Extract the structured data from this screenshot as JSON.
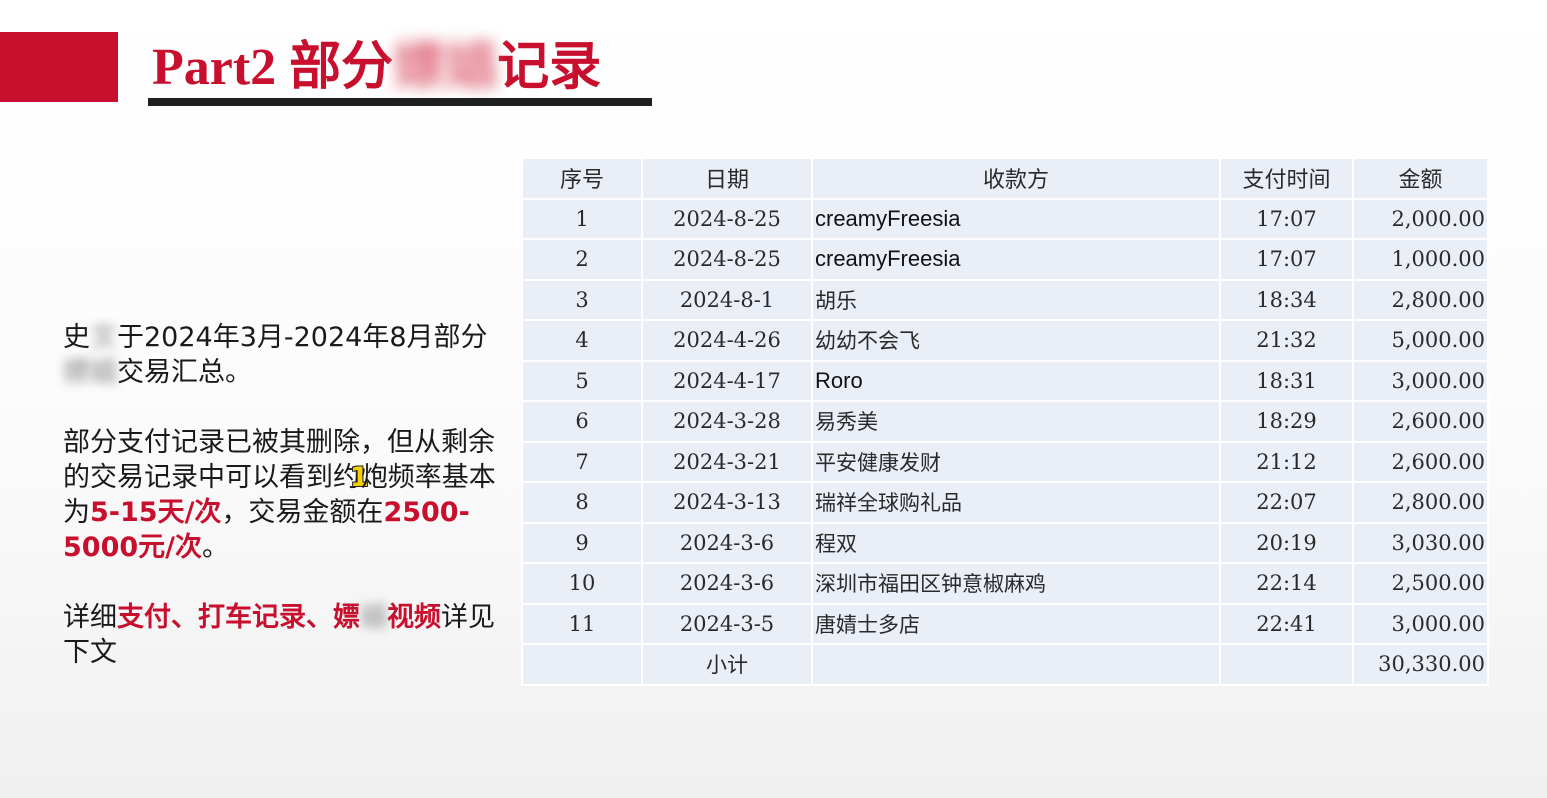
{
  "title": {
    "prefix": "Part2  部分",
    "masked": "嫖娼",
    "suffix": "记录"
  },
  "summary": {
    "p1": [
      {
        "text": "史",
        "style": "plain"
      },
      {
        "text": "文",
        "style": "blur"
      },
      {
        "text": "于2024年3月-2024年8月",
        "style": "plain"
      },
      {
        "text": "部分",
        "style": "plain"
      },
      {
        "text": "嫖娼",
        "style": "blur"
      },
      {
        "text": "交易汇总。",
        "style": "plain"
      }
    ],
    "p2": [
      {
        "text": "部分支付记录已被其删除，但从剩余的交易记录中可以看到约",
        "style": "plain"
      },
      {
        "text": "1",
        "style": "badge"
      },
      {
        "text": "炮",
        "style": "plain"
      },
      {
        "text": "频率基本为",
        "style": "plain"
      },
      {
        "text": "5-15天/次",
        "style": "hl"
      },
      {
        "text": "，交易金额在",
        "style": "plain"
      },
      {
        "text": "2500-5000元/次",
        "style": "hl"
      },
      {
        "text": "。",
        "style": "plain"
      }
    ],
    "p3": [
      {
        "text": "详细",
        "style": "plain"
      },
      {
        "text": "支付、打车记录、嫖",
        "style": "hl"
      },
      {
        "text": "娼",
        "style": "blur"
      },
      {
        "text": "视频",
        "style": "hl"
      },
      {
        "text": "详见下文",
        "style": "plain"
      }
    ]
  },
  "table": {
    "headers": [
      "序号",
      "日期",
      "收款方",
      "支付时间",
      "金额"
    ],
    "rows": [
      [
        "1",
        "2024-8-25",
        "creamyFreesia",
        "17:07",
        "2,000.00"
      ],
      [
        "2",
        "2024-8-25",
        "creamyFreesia",
        "17:07",
        "1,000.00"
      ],
      [
        "3",
        "2024-8-1",
        "胡乐",
        "18:34",
        "2,800.00"
      ],
      [
        "4",
        "2024-4-26",
        "幼幼不会飞",
        "21:32",
        "5,000.00"
      ],
      [
        "5",
        "2024-4-17",
        "Roro",
        "18:31",
        "3,000.00"
      ],
      [
        "6",
        "2024-3-28",
        "易秀美",
        "18:29",
        "2,600.00"
      ],
      [
        "7",
        "2024-3-21",
        "平安健康发财",
        "21:12",
        "2,600.00"
      ],
      [
        "8",
        "2024-3-13",
        "瑞祥全球购礼品",
        "22:07",
        "2,800.00"
      ],
      [
        "9",
        "2024-3-6",
        "程双",
        "20:19",
        "3,030.00"
      ],
      [
        "10",
        "2024-3-6",
        "深圳市福田区钟意椒麻鸡",
        "22:14",
        "2,500.00"
      ],
      [
        "11",
        "2024-3-5",
        "唐婧士多店",
        "22:41",
        "3,000.00"
      ]
    ],
    "subtotal_label": "小计",
    "subtotal_value": "30,330.00"
  },
  "colors": {
    "accent": "#c8102e",
    "table_cell": "#e9eef7",
    "underline": "#1f1f1f"
  }
}
